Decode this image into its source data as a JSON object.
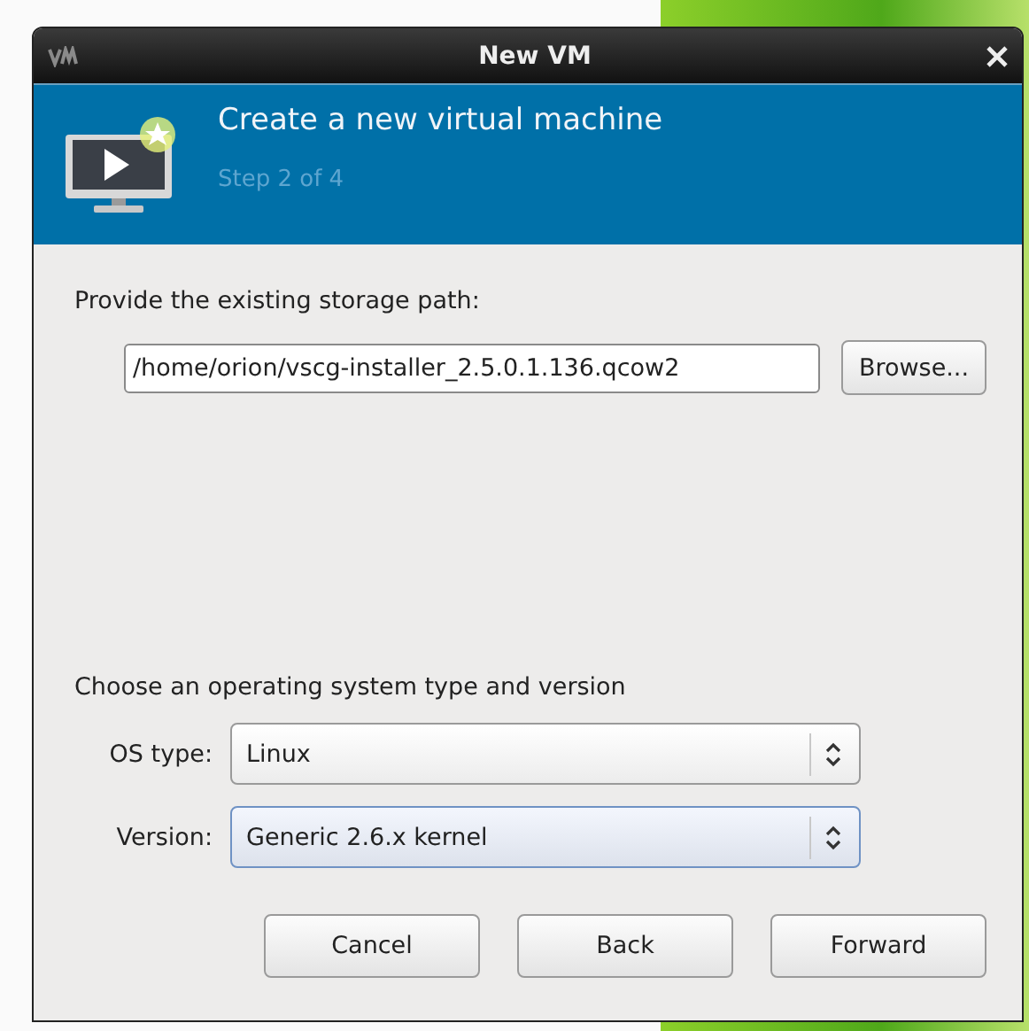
{
  "window": {
    "title": "New VM"
  },
  "header": {
    "title": "Create a new virtual machine",
    "step": "Step 2 of 4"
  },
  "storage": {
    "label": "Provide the existing storage path:",
    "path": "/home/orion/vscg-installer_2.5.0.1.136.qcow2",
    "browse": "Browse..."
  },
  "os": {
    "heading": "Choose an operating system type and version",
    "fields": [
      {
        "label": "OS type:",
        "value": "Linux",
        "focused": false
      },
      {
        "label": "Version:",
        "value": "Generic 2.6.x kernel",
        "focused": true
      }
    ]
  },
  "buttons": [
    "Cancel",
    "Back",
    "Forward"
  ]
}
